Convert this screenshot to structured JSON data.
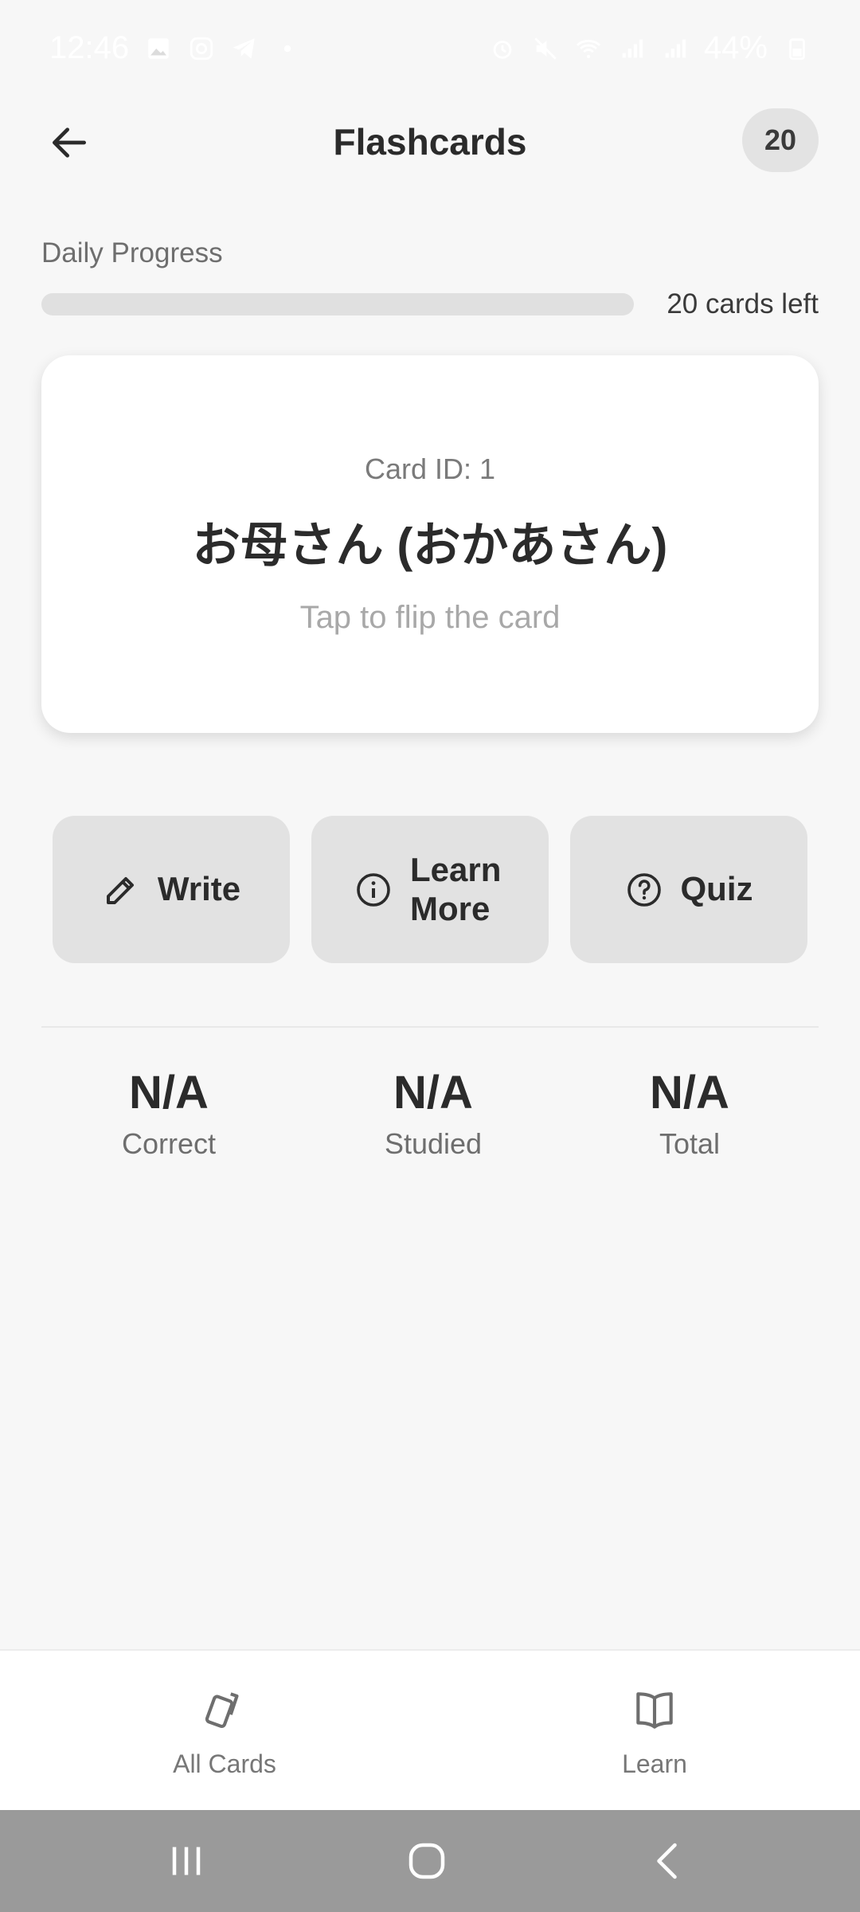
{
  "status_bar": {
    "time": "12:46",
    "battery": "44%",
    "left_icons": [
      "gallery-icon",
      "instagram-icon",
      "telegram-icon",
      "dot-icon"
    ],
    "right_icons": [
      "alarm-icon",
      "mute-icon",
      "wifi-icon",
      "signal-icon",
      "signal-icon",
      "battery-icon"
    ]
  },
  "header": {
    "title": "Flashcards",
    "badge_count": "20",
    "back_icon": "arrow-left-icon"
  },
  "progress": {
    "label": "Daily Progress",
    "status_text": "20 cards left",
    "fraction_complete": 0
  },
  "card": {
    "id_text": "Card ID: 1",
    "term": "お母さん (おかあさん)",
    "hint": "Tap to flip the card"
  },
  "actions": [
    {
      "label": "Write",
      "icon": "pencil-icon"
    },
    {
      "label": "Learn More",
      "icon": "info-icon"
    },
    {
      "label": "Quiz",
      "icon": "help-circle-icon"
    }
  ],
  "stats": [
    {
      "value": "N/A",
      "label": "Correct"
    },
    {
      "value": "N/A",
      "label": "Studied"
    },
    {
      "value": "N/A",
      "label": "Total"
    }
  ],
  "bottom_nav": [
    {
      "label": "All Cards",
      "icon": "cards-icon"
    },
    {
      "label": "Learn",
      "icon": "book-open-icon"
    }
  ],
  "system_nav": [
    "recents-icon",
    "home-icon",
    "back-icon"
  ],
  "colors": {
    "background": "#f7f7f7",
    "card": "#ffffff",
    "button": "#e2e2e2",
    "text": "#2b2b2b",
    "muted": "#6e6e6e",
    "system_nav": "#9a9a9a"
  }
}
